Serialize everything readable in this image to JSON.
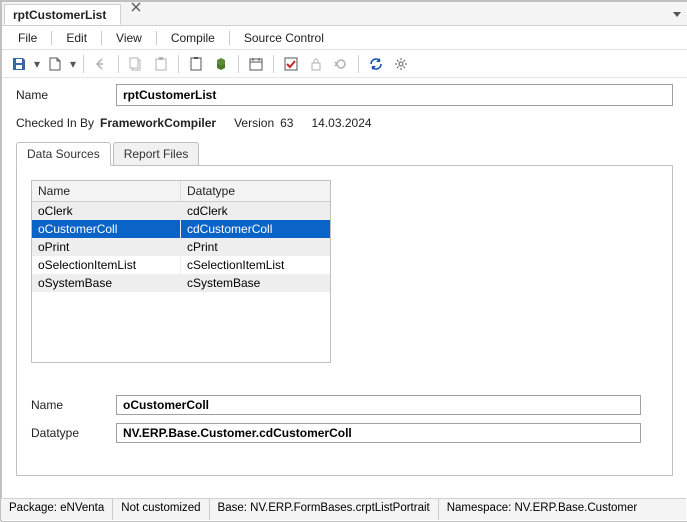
{
  "doc_tab": {
    "title": "rptCustomerList"
  },
  "menu": {
    "file": "File",
    "edit": "Edit",
    "view": "View",
    "compile": "Compile",
    "source_control": "Source Control"
  },
  "toolbar_icons": {
    "save": "save-icon",
    "new": "new-icon",
    "undo": "undo-icon",
    "copy": "copy-icon",
    "paste": "paste-icon",
    "clipboard": "clipboard-icon",
    "module": "module-icon",
    "calendar": "calendar-icon",
    "check": "check-icon",
    "lock": "lock-icon",
    "revert": "revert-icon",
    "refresh": "refresh-icon",
    "gear": "gear-icon"
  },
  "fields": {
    "name_label": "Name",
    "name_value": "rptCustomerList"
  },
  "meta": {
    "checked_in_by_label": "Checked In By",
    "checked_in_by_value": "FrameworkCompiler",
    "version_label": "Version",
    "version_value": "63",
    "date": "14.03.2024"
  },
  "inner_tabs": {
    "data_sources": "Data Sources",
    "report_files": "Report Files"
  },
  "grid": {
    "col_name": "Name",
    "col_datatype": "Datatype",
    "rows": [
      {
        "name": "oClerk",
        "datatype": "cdClerk",
        "selected": false
      },
      {
        "name": "oCustomerColl",
        "datatype": "cdCustomerColl",
        "selected": true
      },
      {
        "name": "oPrint",
        "datatype": "cPrint",
        "selected": false
      },
      {
        "name": "oSelectionItemList",
        "datatype": "cSelectionItemList",
        "selected": false
      },
      {
        "name": "oSystemBase",
        "datatype": "cSystemBase",
        "selected": false
      }
    ]
  },
  "detail": {
    "name_label": "Name",
    "name_value": "oCustomerColl",
    "datatype_label": "Datatype",
    "datatype_value": "NV.ERP.Base.Customer.cdCustomerColl"
  },
  "status": {
    "package": "Package: eNVenta",
    "customized": "Not customized",
    "base": "Base: NV.ERP.FormBases.crptListPortrait",
    "namespace": "Namespace: NV.ERP.Base.Customer"
  }
}
